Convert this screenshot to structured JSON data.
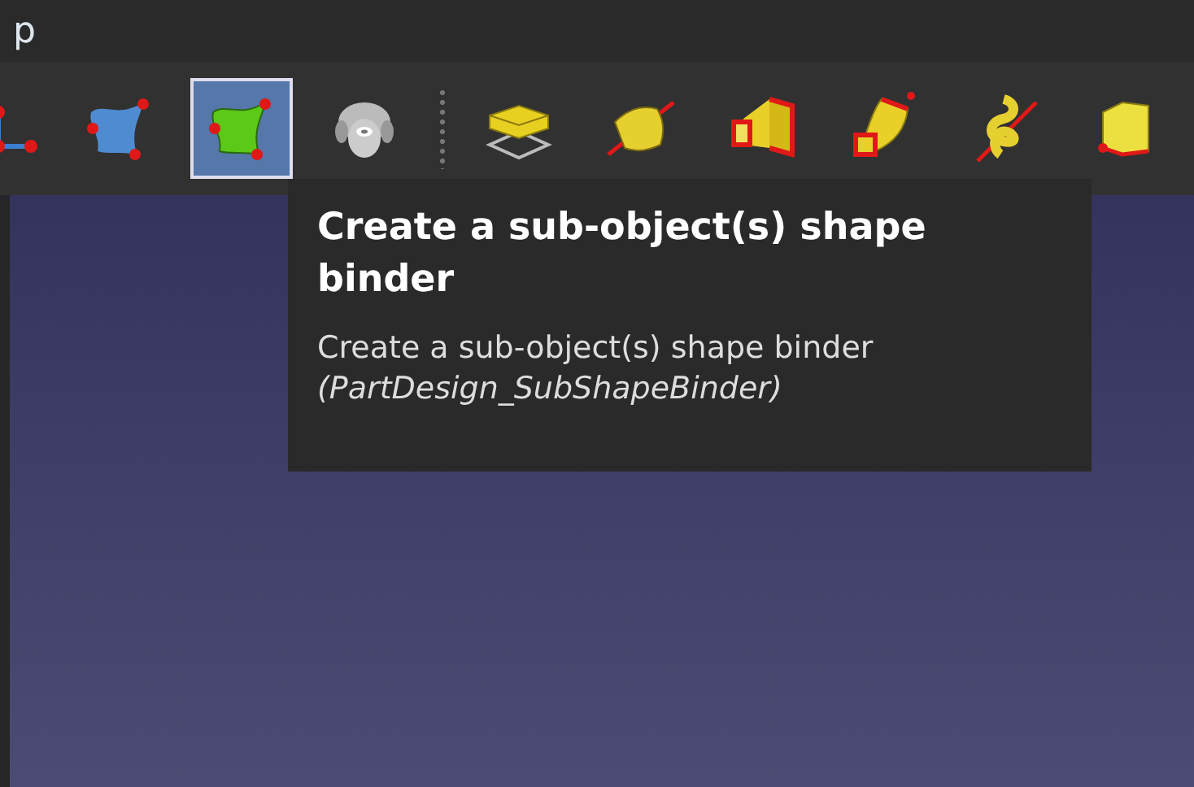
{
  "window": {
    "title": "p"
  },
  "toolbar": {
    "groups": [
      {
        "buttons": [
          {
            "kind": "axes",
            "selected": false
          },
          {
            "kind": "blue-shape",
            "selected": false
          },
          {
            "kind": "green-shape",
            "selected": true
          },
          {
            "kind": "sheep",
            "selected": false
          }
        ]
      },
      {
        "buttons": [
          {
            "kind": "box",
            "selected": false
          },
          {
            "kind": "pipe",
            "selected": false
          },
          {
            "kind": "loft",
            "selected": false
          },
          {
            "kind": "sweep",
            "selected": false
          },
          {
            "kind": "helix",
            "selected": false
          },
          {
            "kind": "cube",
            "selected": false
          }
        ]
      }
    ]
  },
  "tooltip": {
    "title": "Create a sub-object(s) shape binder",
    "description": "Create a sub-object(s) shape binder",
    "command": "(PartDesign_SubShapeBinder)"
  }
}
